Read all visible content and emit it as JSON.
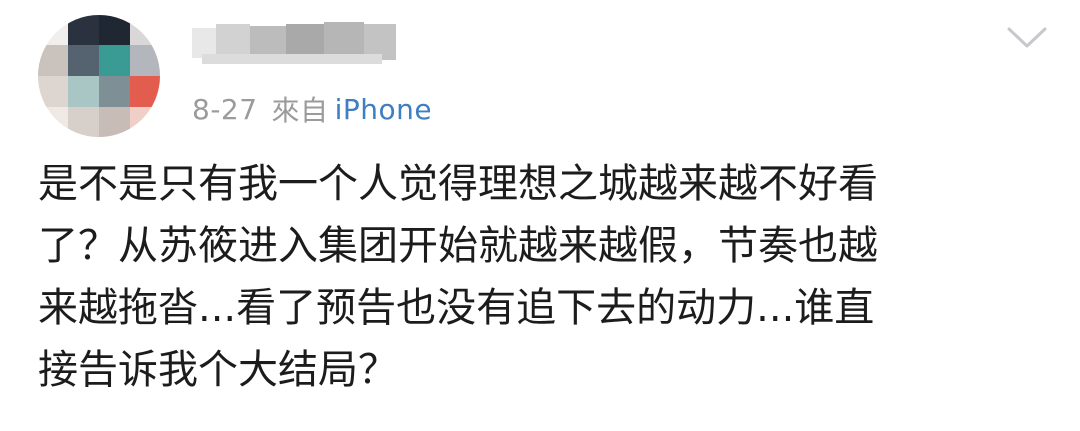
{
  "post": {
    "username": "",
    "date": "8-27",
    "source_prefix": "來自",
    "source_device": "iPhone",
    "body_lines": [
      "是不是只有我一个人觉得理想之城越来越不好看",
      "了？从苏筱进入集团开始就越来越假，节奏也越",
      "来越拖沓...看了预告也没有追下去的动力...谁直",
      "接告诉我个大结局？"
    ]
  },
  "icons": {
    "avatar": "avatar-pixelated",
    "menu": "chevron-down-icon"
  },
  "colors": {
    "meta_gray": "#9b9b9b",
    "link_blue": "#3f7ec2",
    "text": "#1c1c1c",
    "chevron": "#c7c7cc"
  }
}
